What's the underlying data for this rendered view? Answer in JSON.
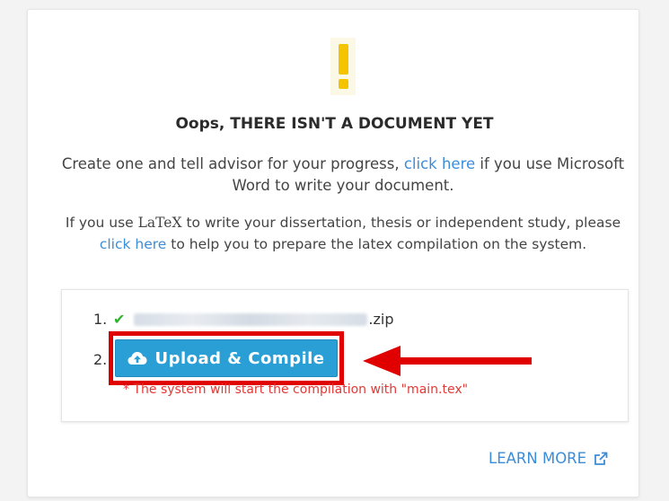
{
  "header": {
    "title": "Oops, THERE ISN'T A DOCUMENT YET"
  },
  "intro": {
    "text_before": "Create one and tell advisor for your progress,",
    "link_label": "click here",
    "text_after": "if you use Microsoft Word to write your document."
  },
  "latex_info": {
    "text_before": "If you use",
    "latex_label": "LaTeX",
    "text_middle": "to write your dissertation, thesis or independent study, please",
    "link_label": "click here",
    "text_after": "to help you to prepare the latex compilation on the system."
  },
  "steps": {
    "step1_number": "1.",
    "step1_check": "✔",
    "file_extension": ".zip",
    "step2_number": "2.",
    "upload_button_label": "Upload & Compile",
    "note": "* The system will start the compilation with \"main.tex\""
  },
  "footer": {
    "learn_more_label": "LEARN MORE"
  },
  "icons": {
    "alert": "exclamation-icon",
    "check": "checkmark-icon",
    "upload": "cloud-upload-icon",
    "external": "external-link-icon",
    "annotation": "red-arrow"
  },
  "colors": {
    "accent": "#2a9fd6",
    "link": "#3c8dd8",
    "warning": "#f5c400",
    "highlight": "#e00000",
    "note": "#e53935"
  }
}
